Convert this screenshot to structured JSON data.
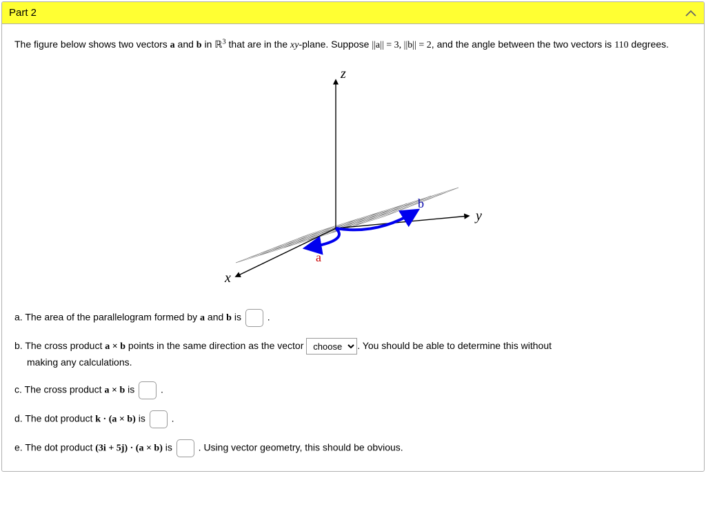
{
  "header": {
    "title": "Part 2"
  },
  "intro": {
    "t1": "The figure below shows two vectors ",
    "a": "a",
    "t2": " and ",
    "b": "b",
    "t3": " in ",
    "R": "ℝ",
    "exp": "3",
    "t4": " that are in the ",
    "xy": "xy",
    "t5": "-plane. Suppose ",
    "na": "||a||",
    "eq1": " = 3, ",
    "nb": "||b||",
    "eq2": " = 2",
    "t6": ", and the angle between the two vectors is ",
    "ang": "110",
    "t7": " degrees."
  },
  "fig": {
    "z": "z",
    "y": "y",
    "x": "x",
    "a": "a",
    "b": "b"
  },
  "qa": {
    "pre": "a. The area of the parallelogram formed by ",
    "a": "a",
    "and": " and ",
    "b": "b",
    "post": " is ",
    "end": "."
  },
  "qb": {
    "pre": "b. The cross product ",
    "axb": "a × b",
    "mid": " points in the same direction as the vector ",
    "choice": "choose",
    "post1": ". You should be able to determine this without",
    "post2": "making any calculations."
  },
  "qc": {
    "pre": "c. The cross product ",
    "axb": "a × b",
    "post": " is ",
    "end": "."
  },
  "qd": {
    "pre": "d. The dot product ",
    "expr": "k · (a × b)",
    "post": " is ",
    "end": "."
  },
  "qe": {
    "pre": "e. The dot product ",
    "expr": "(3i + 5j) · (a × b)",
    "post": " is ",
    "end": ". Using vector geometry, this should be obvious."
  }
}
